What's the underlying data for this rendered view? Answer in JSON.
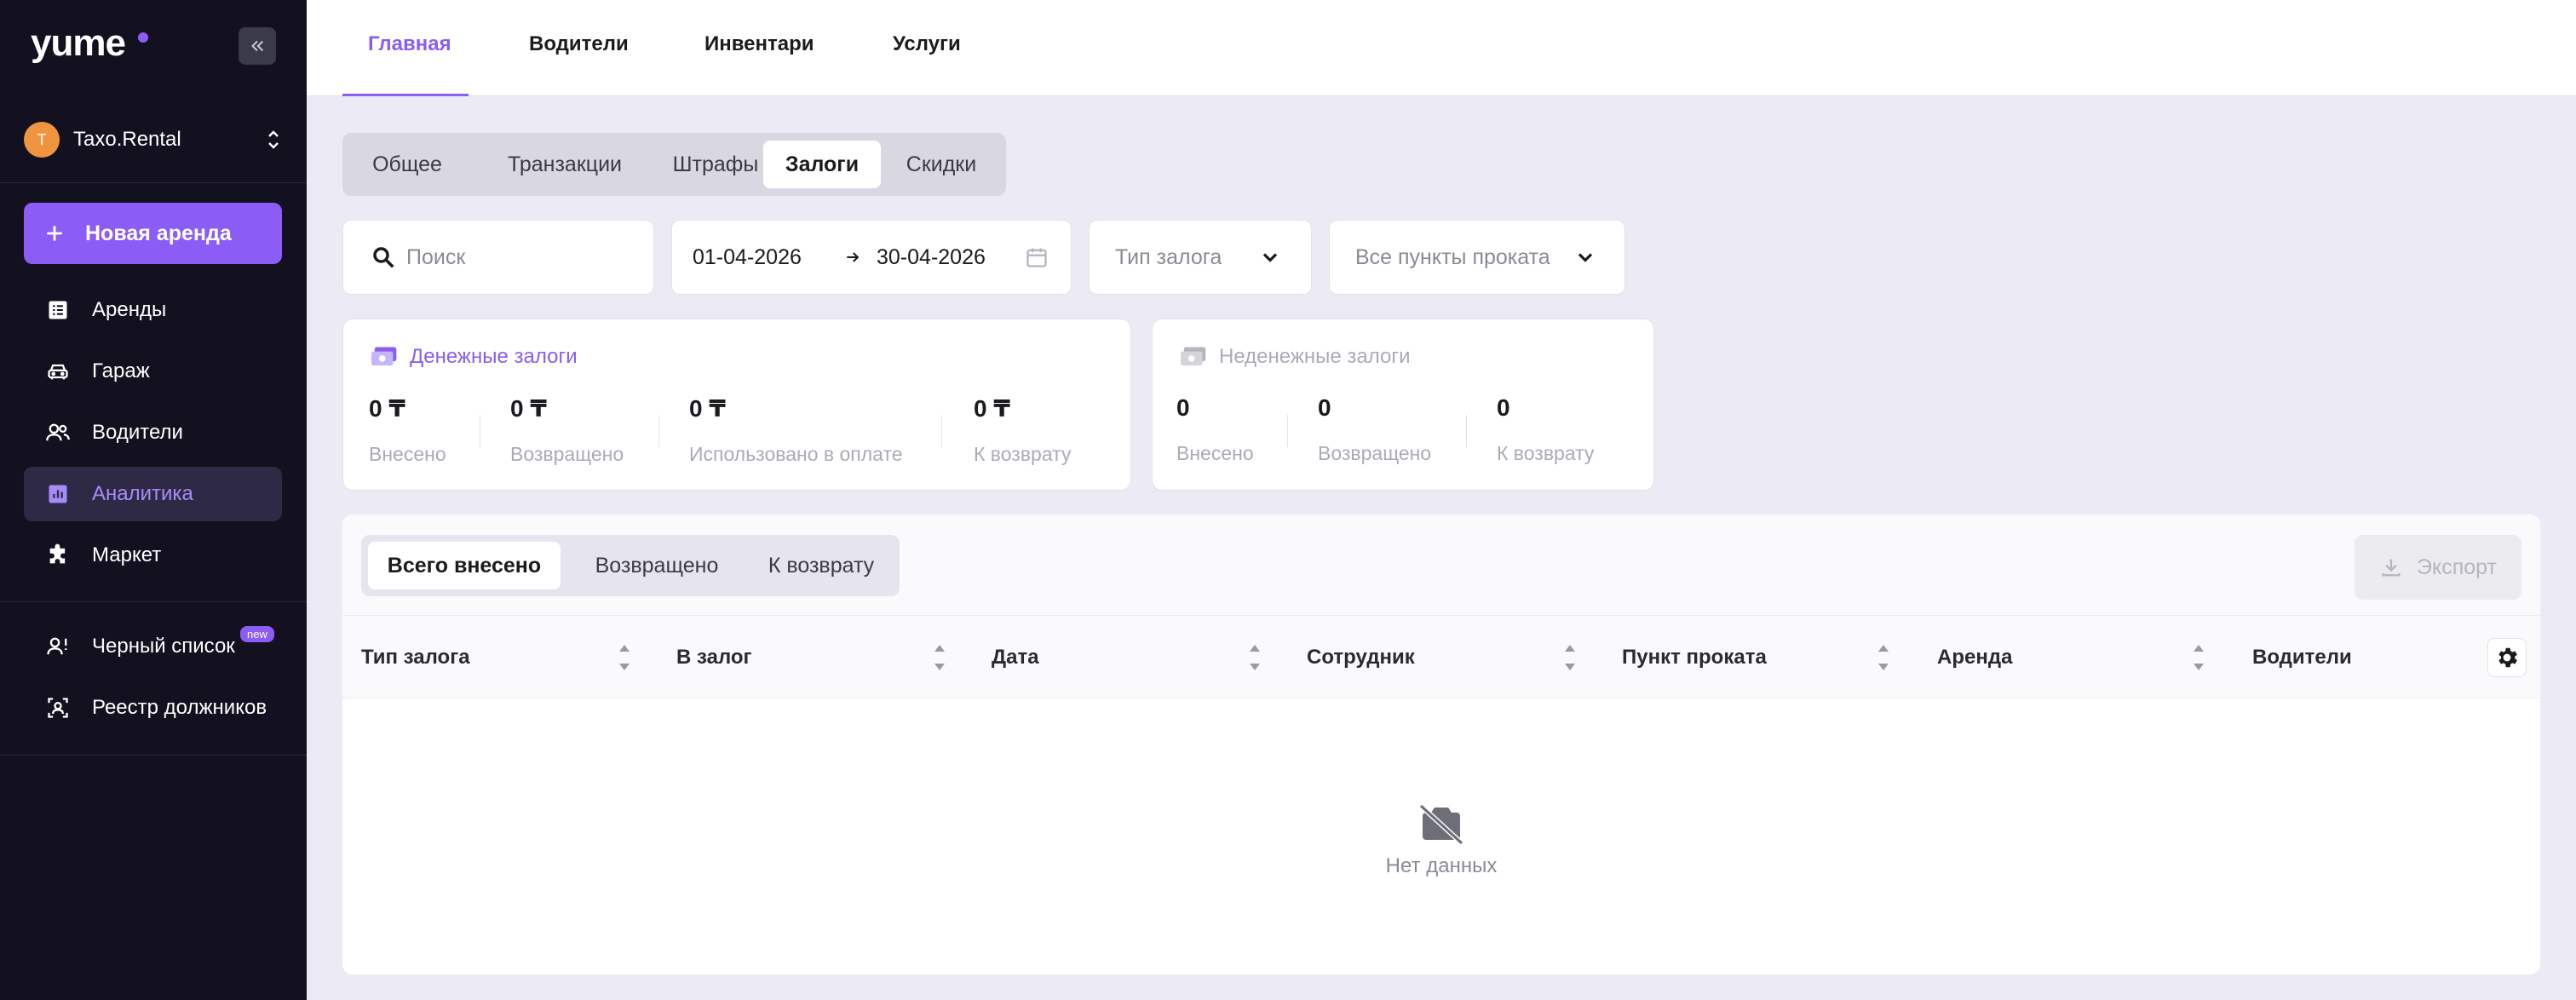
{
  "sidebar": {
    "logo": "yume",
    "org": {
      "initial": "T",
      "name": "Taxo.Rental"
    },
    "new_rental": "Новая аренда",
    "nav": [
      {
        "label": "Аренды",
        "icon": "list-icon"
      },
      {
        "label": "Гараж",
        "icon": "car-icon"
      },
      {
        "label": "Водители",
        "icon": "users-icon"
      },
      {
        "label": "Аналитика",
        "icon": "chart-icon",
        "active": true
      },
      {
        "label": "Маркет",
        "icon": "puzzle-icon"
      }
    ],
    "nav2": [
      {
        "label": "Черный список",
        "icon": "user-warning-icon",
        "badge": "new"
      },
      {
        "label": "Реестр должников",
        "icon": "user-scan-icon"
      }
    ]
  },
  "topnav": {
    "items": [
      "Главная",
      "Водители",
      "Инвентари",
      "Услуги"
    ],
    "active": "Главная"
  },
  "segments": {
    "items": [
      "Общее",
      "Транзакции",
      "Штрафы",
      "Залоги",
      "Скидки"
    ],
    "active": "Залоги"
  },
  "filters": {
    "search_placeholder": "Поиск",
    "date_from": "01-04-2026",
    "date_to": "30-04-2026",
    "deposit_type_placeholder": "Тип залога",
    "points_placeholder": "Все пункты проката"
  },
  "cash_card": {
    "title": "Денежные залоги",
    "stats": [
      {
        "value": "0 ₸",
        "label": "Внесено"
      },
      {
        "value": "0 ₸",
        "label": "Возвращено"
      },
      {
        "value": "0 ₸",
        "label": "Использовано в оплате"
      },
      {
        "value": "0 ₸",
        "label": "К возврату"
      }
    ]
  },
  "noncash_card": {
    "title": "Неденежные залоги",
    "stats": [
      {
        "value": "0",
        "label": "Внесено"
      },
      {
        "value": "0",
        "label": "Возвращено"
      },
      {
        "value": "0",
        "label": "К возврату"
      }
    ]
  },
  "table": {
    "tabs": [
      "Всего внесено",
      "Возвращено",
      "К возврату"
    ],
    "active_tab": "Всего внесено",
    "export_label": "Экспорт",
    "columns": [
      "Тип залога",
      "В залог",
      "Дата",
      "Сотрудник",
      "Пункт проката",
      "Аренда",
      "Водители"
    ],
    "empty_text": "Нет данных"
  },
  "colors": {
    "accent": "#8B5CF6",
    "sidebar_bg": "#13111F",
    "page_bg": "#ECEBF5",
    "avatar": "#F0953F"
  }
}
